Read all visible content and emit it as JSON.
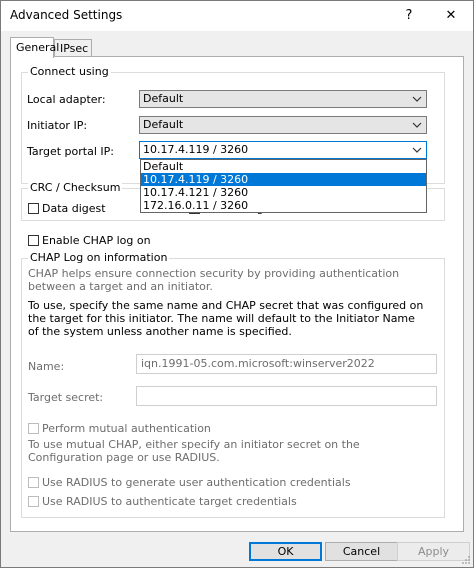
{
  "window": {
    "title": "Advanced Settings",
    "help_glyph": "?",
    "close_glyph": "✕"
  },
  "tabs": [
    {
      "label": "General",
      "active": true
    },
    {
      "label": "IPsec",
      "active": false
    }
  ],
  "connect": {
    "legend": "Connect using",
    "local_adapter_label": "Local adapter:",
    "local_adapter_value": "Default",
    "initiator_ip_label": "Initiator IP:",
    "initiator_ip_value": "Default",
    "target_portal_label": "Target portal IP:",
    "target_portal_value": "10.17.4.119 / 3260",
    "target_portal_options": [
      "Default",
      "10.17.4.119 / 3260",
      "10.17.4.121 / 3260",
      "172.16.0.11 / 3260"
    ],
    "selected_option_index": 1
  },
  "crc": {
    "legend": "CRC / Checksum",
    "data_digest": "Data digest",
    "header_digest": "Header digest"
  },
  "chap": {
    "enable_label": "Enable CHAP log on",
    "legend": "CHAP Log on information",
    "help_text": "CHAP helps ensure connection security by providing authentication between a target and an initiator.",
    "instructions": "To use, specify the same name and CHAP secret that was configured on the target for this initiator.  The name will default to the Initiator Name of the system unless another name is specified.",
    "name_label": "Name:",
    "name_value": "iqn.1991-05.com.microsoft:winserver2022",
    "secret_label": "Target secret:",
    "secret_value": "",
    "mutual_label": "Perform mutual authentication",
    "mutual_help": "To use mutual CHAP, either specify an initiator secret on the Configuration page or use RADIUS.",
    "radius_user_label": "Use RADIUS to generate user authentication credentials",
    "radius_target_label": "Use RADIUS to authenticate target credentials"
  },
  "buttons": {
    "ok": "OK",
    "cancel": "Cancel",
    "apply": "Apply"
  },
  "colors": {
    "accent": "#0078d7",
    "selection_text": "#ffffff",
    "disabled_text": "#6d6d6d"
  }
}
